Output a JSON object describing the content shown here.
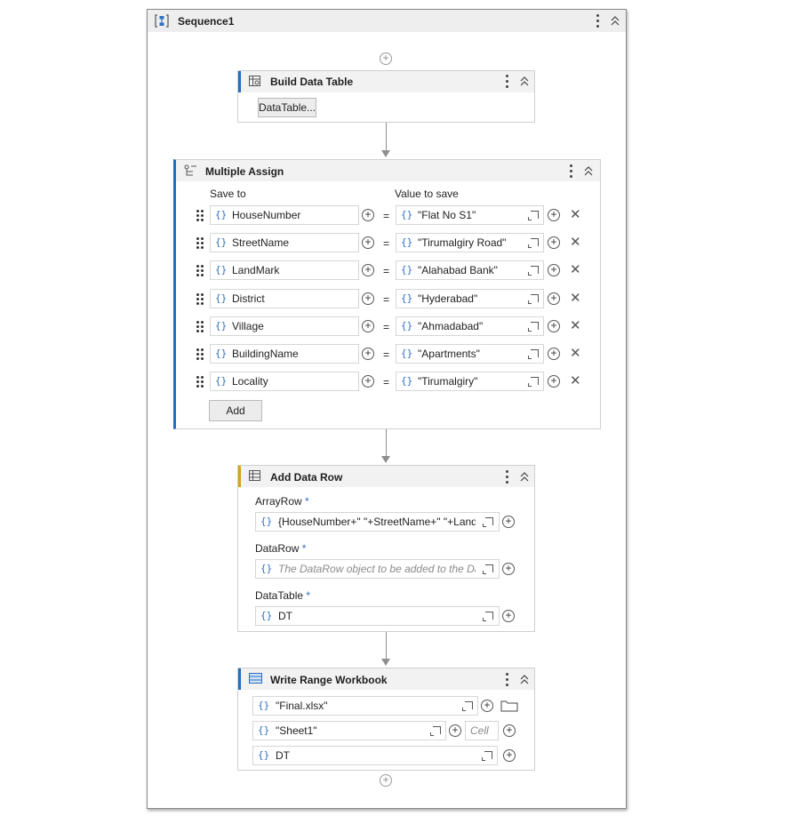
{
  "sequence": {
    "title": "Sequence1"
  },
  "build_data_table": {
    "title": "Build Data Table",
    "button": "DataTable..."
  },
  "multiple_assign": {
    "title": "Multiple Assign",
    "col_save_to": "Save to",
    "col_value": "Value to save",
    "equals": "=",
    "rows": [
      {
        "save_to": "HouseNumber",
        "value": "\"Flat No S1\""
      },
      {
        "save_to": "StreetName",
        "value": "\"Tirumalgiry Road\""
      },
      {
        "save_to": "LandMark",
        "value": "\"Alahabad Bank\""
      },
      {
        "save_to": "District",
        "value": "\"Hyderabad\""
      },
      {
        "save_to": "Village",
        "value": "\"Ahmadabad\""
      },
      {
        "save_to": "BuildingName",
        "value": "\"Apartments\""
      },
      {
        "save_to": "Locality",
        "value": "\"Tirumalgiry\""
      }
    ],
    "add_button": "Add"
  },
  "add_data_row": {
    "title": "Add Data Row",
    "array_row_label": "ArrayRow",
    "array_row_value": "{HouseNumber+\" \"+StreetName+\" \"+LandMark",
    "data_row_label": "DataRow",
    "data_row_placeholder": "The DataRow object to be added to the DataTable",
    "data_table_label": "DataTable",
    "data_table_value": "DT",
    "required_mark": "*"
  },
  "write_range": {
    "title": "Write Range Workbook",
    "workbook_path": "\"Final.xlsx\"",
    "sheet_name": "\"Sheet1\"",
    "cell_placeholder": "Cell",
    "data_table": "DT"
  },
  "icons": {
    "brace": "{}",
    "plus": "+",
    "close": "✕",
    "collapse": "⌃⌃"
  },
  "colors": {
    "accent": "#1f6fbf",
    "gold": "#d6a21a",
    "brace": "#2f6fc0"
  }
}
